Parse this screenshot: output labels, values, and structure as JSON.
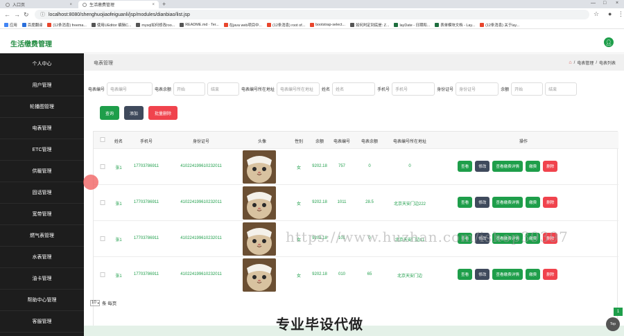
{
  "browser": {
    "tabs": [
      {
        "label": "入口页"
      },
      {
        "label": "生活缴费管理"
      }
    ],
    "url": "localhost:8080/shenghuojiaofeiguanli/jsp/modules/dianbiao/list.jsp",
    "bookmarks": [
      {
        "label": "应用",
        "color": "#4285f4"
      },
      {
        "label": "百度翻译",
        "color": "#2a6fdb"
      },
      {
        "label": "(12条消息) freema...",
        "color": "#e8452c"
      },
      {
        "label": "使用UEditor 编辑C...",
        "color": "#555555"
      },
      {
        "label": "mysql如何修改roo...",
        "color": "#555555"
      },
      {
        "label": "README.md · Ter...",
        "color": "#555555"
      },
      {
        "label": "在java web项目中...",
        "color": "#e8452c"
      },
      {
        "label": "(12条消息) root of...",
        "color": "#e8452c"
      },
      {
        "label": "bootstrap-select...",
        "color": "#e8452c"
      },
      {
        "label": "如何判定到底是: Z...",
        "color": "#555555"
      },
      {
        "label": "layDate - 日期和...",
        "color": "#1e6e3e"
      },
      {
        "label": "表单模块文档 - Lay...",
        "color": "#1e6e3e"
      },
      {
        "label": "(12条消息) 关于lay...",
        "color": "#e8452c"
      }
    ]
  },
  "app": {
    "title": "生活缴费管理"
  },
  "sidebar": {
    "items": [
      {
        "label": "个人中心"
      },
      {
        "label": "用户管理"
      },
      {
        "label": "轮播图管理"
      },
      {
        "label": "电表管理"
      },
      {
        "label": "ETC管理"
      },
      {
        "label": "供暖管理"
      },
      {
        "label": "固话管理"
      },
      {
        "label": "宽带管理"
      },
      {
        "label": "燃气表管理"
      },
      {
        "label": "水表管理"
      },
      {
        "label": "油卡管理"
      },
      {
        "label": "帮助中心管理"
      },
      {
        "label": "客服管理"
      }
    ]
  },
  "page": {
    "title": "电表管理",
    "breadcrumb": [
      "电表管理",
      "电表列表"
    ]
  },
  "search": {
    "fields": [
      {
        "label": "电表编号",
        "placeholder": "电表编号",
        "width": 66
      },
      {
        "label": "电表余额",
        "placeholder": "开始",
        "width": 46
      },
      {
        "label": "",
        "placeholder": "结束",
        "width": 46
      },
      {
        "label": "电表编号所在地址",
        "placeholder": "电表编号所在地址",
        "width": 62
      },
      {
        "label": "姓名",
        "placeholder": "姓名",
        "width": 62
      },
      {
        "label": "手机号",
        "placeholder": "手机号",
        "width": 62
      },
      {
        "label": "身份证号",
        "placeholder": "身份证号",
        "width": 62
      },
      {
        "label": "余额",
        "placeholder": "开始",
        "width": 46
      },
      {
        "label": "",
        "placeholder": "结束",
        "width": 46
      }
    ]
  },
  "toolbar": {
    "query": "查询",
    "add": "添加",
    "batch_delete": "批量删除"
  },
  "table": {
    "columns": [
      "姓名",
      "手机号",
      "身份证号",
      "头像",
      "性别",
      "余额",
      "电表编号",
      "电表余额",
      "电表编号所在地址",
      "操作"
    ],
    "rows": [
      {
        "name": "张1",
        "phone": "17703786911",
        "idcard": "410224199610232011",
        "gender": "女",
        "balance": "9202.18",
        "meter_no": "757",
        "meter_balance": "0",
        "address": "0"
      },
      {
        "name": "张1",
        "phone": "17703786911",
        "idcard": "410224199610232011",
        "gender": "女",
        "balance": "9202.18",
        "meter_no": "1011",
        "meter_balance": "28.5",
        "address": "北京天安门边222"
      },
      {
        "name": "张1",
        "phone": "17703786911",
        "idcard": "410224199610232011",
        "gender": "女",
        "balance": "9202.18",
        "meter_no": "101",
        "meter_balance": "0",
        "address": "北京天安门边11"
      },
      {
        "name": "张1",
        "phone": "17703786911",
        "idcard": "410224199610232011",
        "gender": "女",
        "balance": "9202.18",
        "meter_no": "010",
        "meter_balance": "65",
        "address": "北京天安门边"
      }
    ],
    "row_actions": {
      "view": "查看",
      "edit": "修改",
      "view_payment": "查看缴费详情",
      "pay": "缴费",
      "delete": "删除"
    }
  },
  "pager": {
    "page_size": "10",
    "suffix": "条 每页"
  },
  "overlay": {
    "watermark": "https://www.huzhan.com/ishop39397",
    "caption": "专业毕设代做",
    "page_badge": "1",
    "top_button": "Top"
  },
  "colors": {
    "primary": "#1e9e4a",
    "dark": "#3f4a5c",
    "danger": "#f0434d",
    "sidebar": "#1d1d1d"
  }
}
